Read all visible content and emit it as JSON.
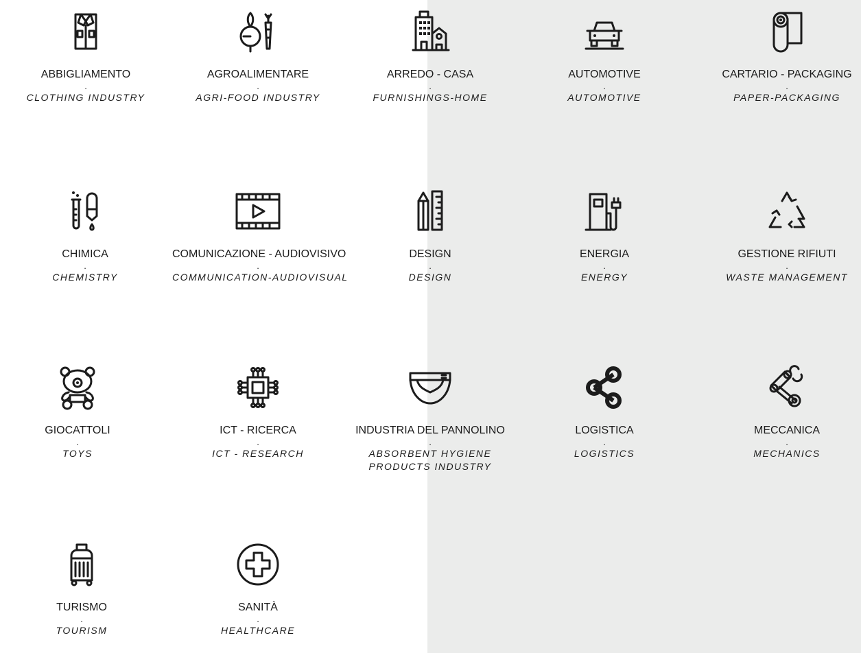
{
  "sectors": [
    {
      "icon": "shirt-icon",
      "it": "ABBIGLIAMENTO",
      "dot": ".",
      "en": "CLOTHING INDUSTRY"
    },
    {
      "icon": "vegetables-icon",
      "it": "AGROALIMENTARE",
      "dot": ".",
      "en": "AGRI-FOOD INDUSTRY"
    },
    {
      "icon": "buildings-icon",
      "it": "ARREDO - CASA",
      "dot": ".",
      "en": "FURNISHINGS-HOME"
    },
    {
      "icon": "car-icon",
      "it": "AUTOMOTIVE",
      "dot": ".",
      "en": "AUTOMOTIVE"
    },
    {
      "icon": "paper-roll-icon",
      "it": "CARTARIO - PACKAGING",
      "dot": ".",
      "en": "PAPER-PACKAGING"
    },
    {
      "icon": "test-tubes-icon",
      "it": "CHIMICA",
      "dot": ".",
      "en": "CHEMISTRY"
    },
    {
      "icon": "film-strip-icon",
      "it": "COMUNICAZIONE - AUDIOVISIVO",
      "dot": ".",
      "en": "COMMUNICATION-AUDIOVISUAL"
    },
    {
      "icon": "pencil-ruler-icon",
      "it": "DESIGN",
      "dot": ".",
      "en": "DESIGN"
    },
    {
      "icon": "charging-station-icon",
      "it": "ENERGIA",
      "dot": ".",
      "en": "ENERGY"
    },
    {
      "icon": "recycle-icon",
      "it": "GESTIONE RIFIUTI",
      "dot": ".",
      "en": "WASTE MANAGEMENT"
    },
    {
      "icon": "teddy-bear-icon",
      "it": "GIOCATTOLI",
      "dot": ".",
      "en": "TOYS"
    },
    {
      "icon": "microchip-icon",
      "it": "ICT - RICERCA",
      "dot": ".",
      "en": "ICT - RESEARCH"
    },
    {
      "icon": "diaper-icon",
      "it": "INDUSTRIA DEL PANNOLINO",
      "dot": ".",
      "en": "ABSORBENT HYGIENE PRODUCTS INDUSTRY"
    },
    {
      "icon": "share-network-icon",
      "it": "LOGISTICA",
      "dot": ".",
      "en": "LOGISTICS"
    },
    {
      "icon": "robot-arm-icon",
      "it": "MECCANICA",
      "dot": ".",
      "en": "MECHANICS"
    },
    {
      "icon": "suitcase-icon",
      "it": "TURISMO",
      "dot": ".",
      "en": "TOURISM"
    },
    {
      "icon": "medical-cross-icon",
      "it": "SANITÀ",
      "dot": ".",
      "en": "HEALTHCARE"
    }
  ],
  "colors": {
    "background": "#ffffff",
    "panel": "#ebeceb",
    "ink": "#1c1c1c"
  }
}
